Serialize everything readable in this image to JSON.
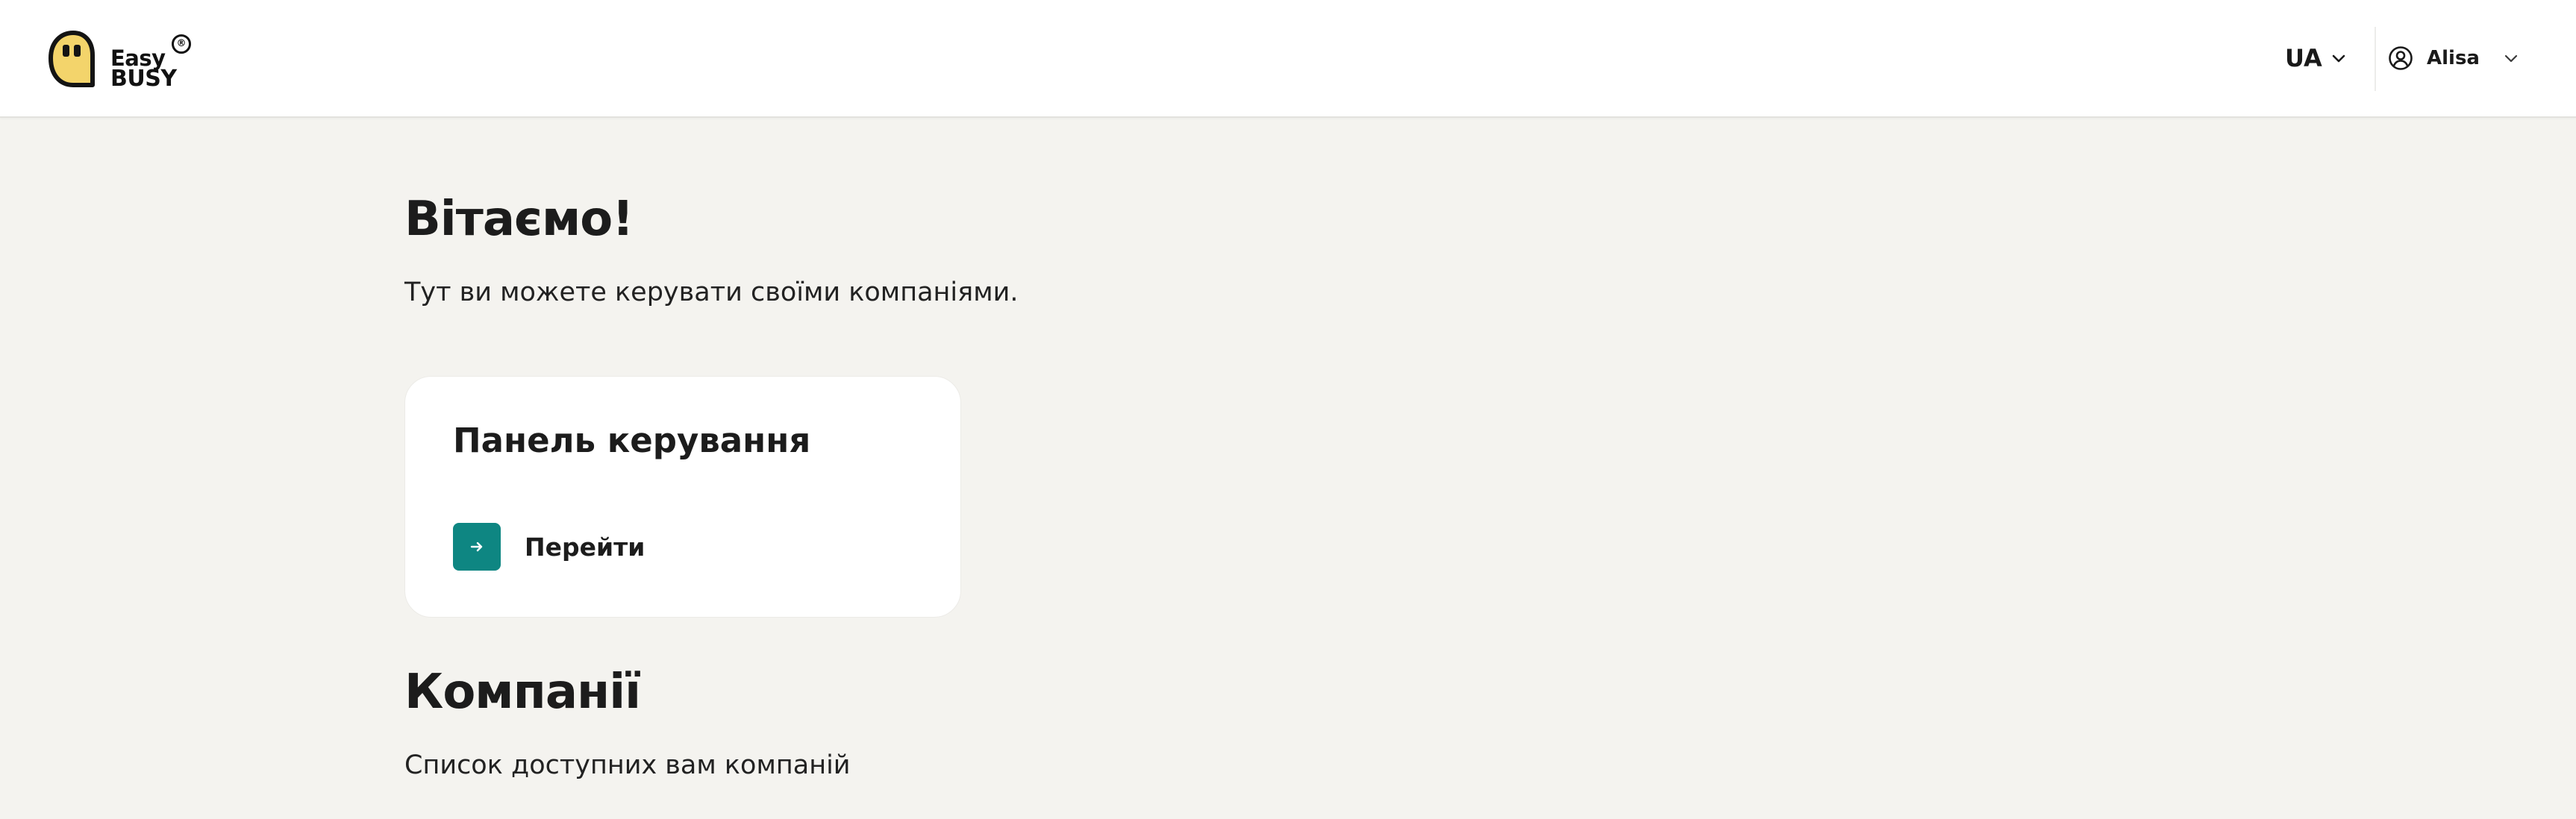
{
  "header": {
    "logo": {
      "line1": "Easy",
      "line2": "BUSY",
      "reg_mark": "®",
      "accent_color": "#f3d46b"
    },
    "language": {
      "selected": "UA",
      "icon": "chevron-down-icon"
    },
    "user": {
      "icon": "user-circle-icon",
      "name": "Alisa",
      "dropdown_icon": "chevron-down-icon"
    }
  },
  "main": {
    "welcome_title": "Вітаємо!",
    "welcome_subtitle": "Тут ви можете керувати своїми компаніями.",
    "dashboard_card": {
      "title": "Панель керування",
      "action_label": "Перейти",
      "action_icon": "arrow-right-icon",
      "action_color": "#0e8682"
    },
    "companies_title": "Компанії",
    "companies_subtitle": "Список доступних вам компаній"
  },
  "colors": {
    "page_background": "#f4f3ef",
    "card_background": "#ffffff",
    "primary": "#0e8682"
  }
}
